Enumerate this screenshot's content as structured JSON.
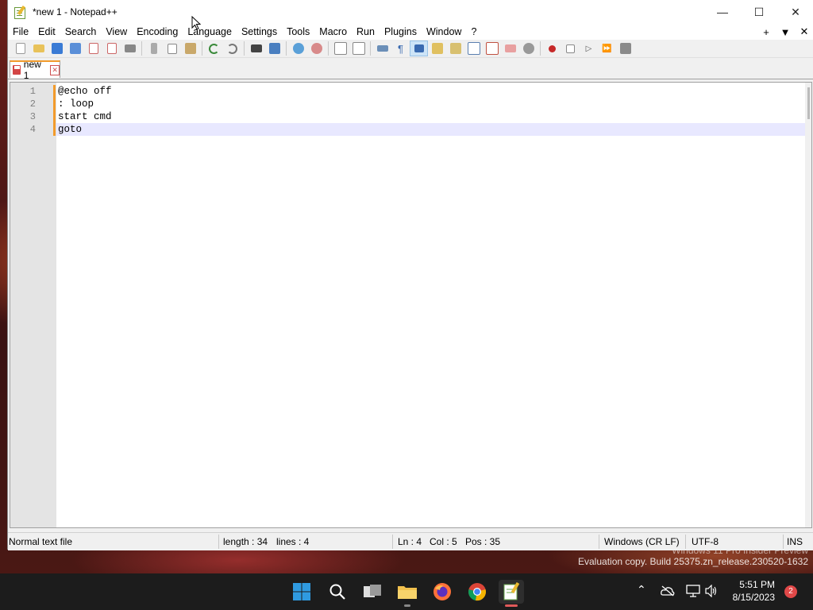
{
  "window": {
    "title": "*new 1 - Notepad++"
  },
  "menu": [
    "File",
    "Edit",
    "Search",
    "View",
    "Encoding",
    "Language",
    "Settings",
    "Tools",
    "Macro",
    "Run",
    "Plugins",
    "Window",
    "?"
  ],
  "menu_right": {
    "add": "+",
    "dropdown": "▼",
    "close": "✕"
  },
  "tab": {
    "label": "new 1",
    "close": "✕"
  },
  "editor": {
    "lines": [
      {
        "num": "1",
        "text": "@echo off"
      },
      {
        "num": "2",
        "text": ": loop"
      },
      {
        "num": "3",
        "text": "start cmd"
      },
      {
        "num": "4",
        "text": "goto"
      }
    ],
    "current_line": 4
  },
  "status": {
    "file_type": "Normal text file",
    "length": "length : 34",
    "lines": "lines : 4",
    "ln": "Ln : 4",
    "col": "Col : 5",
    "pos": "Pos : 35",
    "eol": "Windows (CR LF)",
    "encoding": "UTF-8",
    "mode": "INS"
  },
  "watermark": {
    "line1": "Windows 11 Pro Insider Preview",
    "line2": "Evaluation copy. Build 25375.zn_release.230520-1632"
  },
  "taskbar": {
    "time": "5:51 PM",
    "date": "8/15/2023",
    "notifications": "2"
  },
  "colors": {
    "accent": "#f29b2c",
    "current_line": "#e8e8ff",
    "gutter": "#e4e4e4"
  }
}
